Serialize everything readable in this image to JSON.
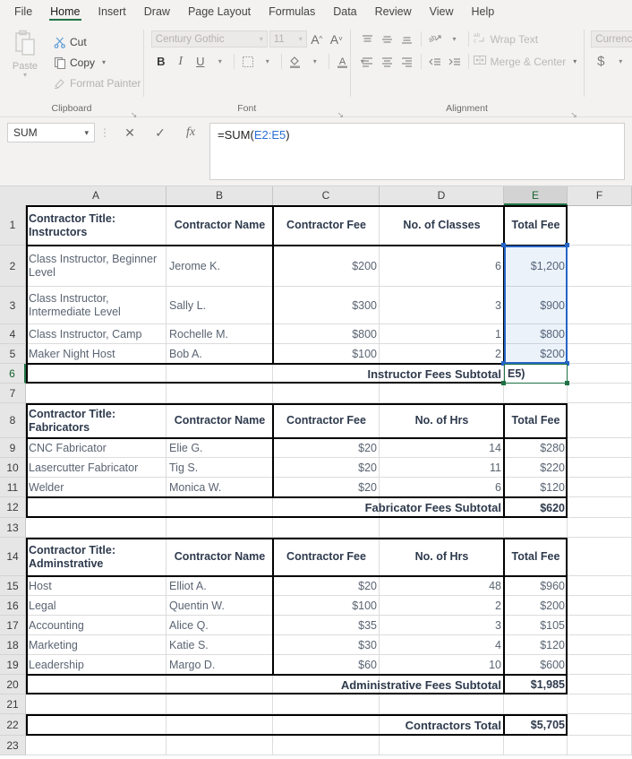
{
  "ribbon": {
    "tabs": [
      {
        "label": "File",
        "active": false
      },
      {
        "label": "Home",
        "active": true
      },
      {
        "label": "Insert",
        "active": false
      },
      {
        "label": "Draw",
        "active": false
      },
      {
        "label": "Page Layout",
        "active": false
      },
      {
        "label": "Formulas",
        "active": false
      },
      {
        "label": "Data",
        "active": false
      },
      {
        "label": "Review",
        "active": false
      },
      {
        "label": "View",
        "active": false
      },
      {
        "label": "Help",
        "active": false
      }
    ],
    "accent_color": "#217346",
    "clipboard": {
      "group_label": "Clipboard",
      "paste_label": "Paste",
      "cut_label": "Cut",
      "copy_label": "Copy",
      "format_painter_label": "Format Painter"
    },
    "font": {
      "group_label": "Font",
      "font_name": "Century Gothic",
      "font_size": "11",
      "bold_label": "B",
      "italic_label": "I",
      "underline_label": "U",
      "grow_font_label": "A",
      "shrink_font_label": "A"
    },
    "alignment": {
      "group_label": "Alignment",
      "wrap_text_label": "Wrap Text",
      "merge_center_label": "Merge & Center"
    },
    "number": {
      "format_value": "Currency",
      "currency_label": "$"
    }
  },
  "formula_bar": {
    "name_box_value": "SUM",
    "cancel_label": "✕",
    "confirm_label": "✓",
    "insert_function_label": "fx",
    "formula_prefix": "=SUM(",
    "formula_ref": "E2:E5",
    "formula_suffix": ")"
  },
  "sheet": {
    "columns": [
      "A",
      "B",
      "C",
      "D",
      "E",
      "F"
    ],
    "selected_column": "E",
    "active_row": "6",
    "rows": [
      "1",
      "2",
      "3",
      "4",
      "5",
      "6",
      "7",
      "8",
      "9",
      "10",
      "11",
      "12",
      "13",
      "14",
      "15",
      "16",
      "17",
      "18",
      "19",
      "20",
      "21",
      "22",
      "23"
    ],
    "edit_cell_text": "E5)",
    "blocks": [
      {
        "name": "instructors",
        "header": [
          "Contractor Title: Instructors",
          "Contractor Name",
          "Contractor Fee",
          "No. of Classes",
          "Total Fee"
        ],
        "rows": [
          [
            "Class Instructor, Beginner Level",
            "Jerome K.",
            "$200",
            "6",
            "$1,200"
          ],
          [
            "Class Instructor, Intermediate Level",
            "Sally L.",
            "$300",
            "3",
            "$900"
          ],
          [
            "Class Instructor, Camp",
            "Rochelle M.",
            "$800",
            "1",
            "$800"
          ],
          [
            "Maker Night Host",
            "Bob A.",
            "$100",
            "2",
            "$200"
          ]
        ],
        "subtotal_label": "Instructor Fees Subtotal",
        "subtotal_value": ""
      },
      {
        "name": "fabricators",
        "header": [
          "Contractor Title: Fabricators",
          "Contractor Name",
          "Contractor Fee",
          "No. of Hrs",
          "Total Fee"
        ],
        "rows": [
          [
            "CNC Fabricator",
            "Elie G.",
            "$20",
            "14",
            "$280"
          ],
          [
            "Lasercutter Fabricator",
            "Tig S.",
            "$20",
            "11",
            "$220"
          ],
          [
            "Welder",
            "Monica W.",
            "$20",
            "6",
            "$120"
          ]
        ],
        "subtotal_label": "Fabricator Fees Subtotal",
        "subtotal_value": "$620"
      },
      {
        "name": "administrative",
        "header": [
          "Contractor Title: Adminstrative",
          "Contractor Name",
          "Contractor Fee",
          "No. of Hrs",
          "Total Fee"
        ],
        "rows": [
          [
            "Host",
            "Elliot A.",
            "$20",
            "48",
            "$960"
          ],
          [
            "Legal",
            "Quentin W.",
            "$100",
            "2",
            "$200"
          ],
          [
            "Accounting",
            "Alice Q.",
            "$35",
            "3",
            "$105"
          ],
          [
            "Marketing",
            "Katie S.",
            "$30",
            "4",
            "$120"
          ],
          [
            "Leadership",
            "Margo D.",
            "$60",
            "10",
            "$600"
          ]
        ],
        "subtotal_label": "Administrative Fees Subtotal",
        "subtotal_value": "$1,985"
      }
    ],
    "grand_total_label": "Contractors Total",
    "grand_total_value": "$5,705"
  }
}
